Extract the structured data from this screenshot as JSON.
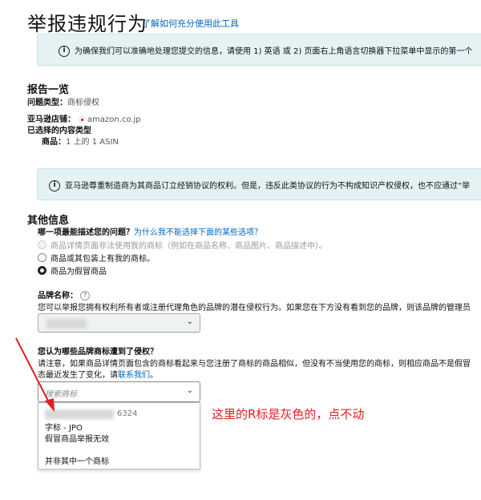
{
  "header": {
    "title": "举报违规行为",
    "help_link": "了解如何充分使用此工具"
  },
  "info_box_1": {
    "text": "为确保我们可以准确地处理您提交的信息，请使用 1) 英语 或 2) 页面右上角语言切换器下拉菜单中显示的第一个"
  },
  "summary": {
    "title": "报告一览",
    "issue_type_label": "问题类型：",
    "issue_type_value": "商标侵权",
    "store_label": "亚马逊店铺：",
    "store_value": "amazon.co.jp",
    "content_type_label": "已选择的内容类型",
    "product_label": "商品：",
    "product_value": "1 上的 1 ASIN"
  },
  "info_box_2": {
    "text": "亚马逊尊重制造商为其商品订立经销协议的权利。但是，违反此类协议的行为不构成知识产权侵权，也不应通过“举"
  },
  "other_info": {
    "title": "其他信息",
    "question": "哪一项最能描述您的问题？",
    "question_link": "为什么我不能选择下面的某些选项？",
    "options": [
      {
        "label": "商品详情页面非法使用我的商标（例如在商品名称、商品图片、商品描述中）。",
        "state": "disabled"
      },
      {
        "label": "商品或其包装上有我的商标。",
        "state": "unselected"
      },
      {
        "label": "商品为假冒商品",
        "state": "selected"
      }
    ]
  },
  "brand": {
    "label": "品牌名称：",
    "help": "?",
    "description": "您可以举报您拥有权利所有者或注册代理角色的品牌的潜在侵权行为。如果您在下方没有看到您的品牌，则该品牌的管理员"
  },
  "trademark": {
    "question": "您认为哪些品牌商标遭到了侵权？",
    "desc_line1": "请注意，如果商品详情页面包含的商标看起来与您注册了商标的商品相似，但没有不当使用您的商标，则相应商品不是假冒",
    "desc_line2_prefix": "态最近发生了变化，请",
    "desc_line2_link": "联系我们",
    "desc_line2_suffix": "。",
    "search_placeholder": "搜索商标",
    "dropdown": {
      "item1_number": "6324",
      "item1_type": "字标 - JPO",
      "item1_note": "假冒商品举报无效",
      "item2": "并非其中一个商标"
    }
  },
  "annotation": {
    "text": "这里的R标是灰色的，点不动",
    "color": "#e02020"
  },
  "colors": {
    "link": "#0066c0",
    "info_bg": "#e4f2f4"
  }
}
